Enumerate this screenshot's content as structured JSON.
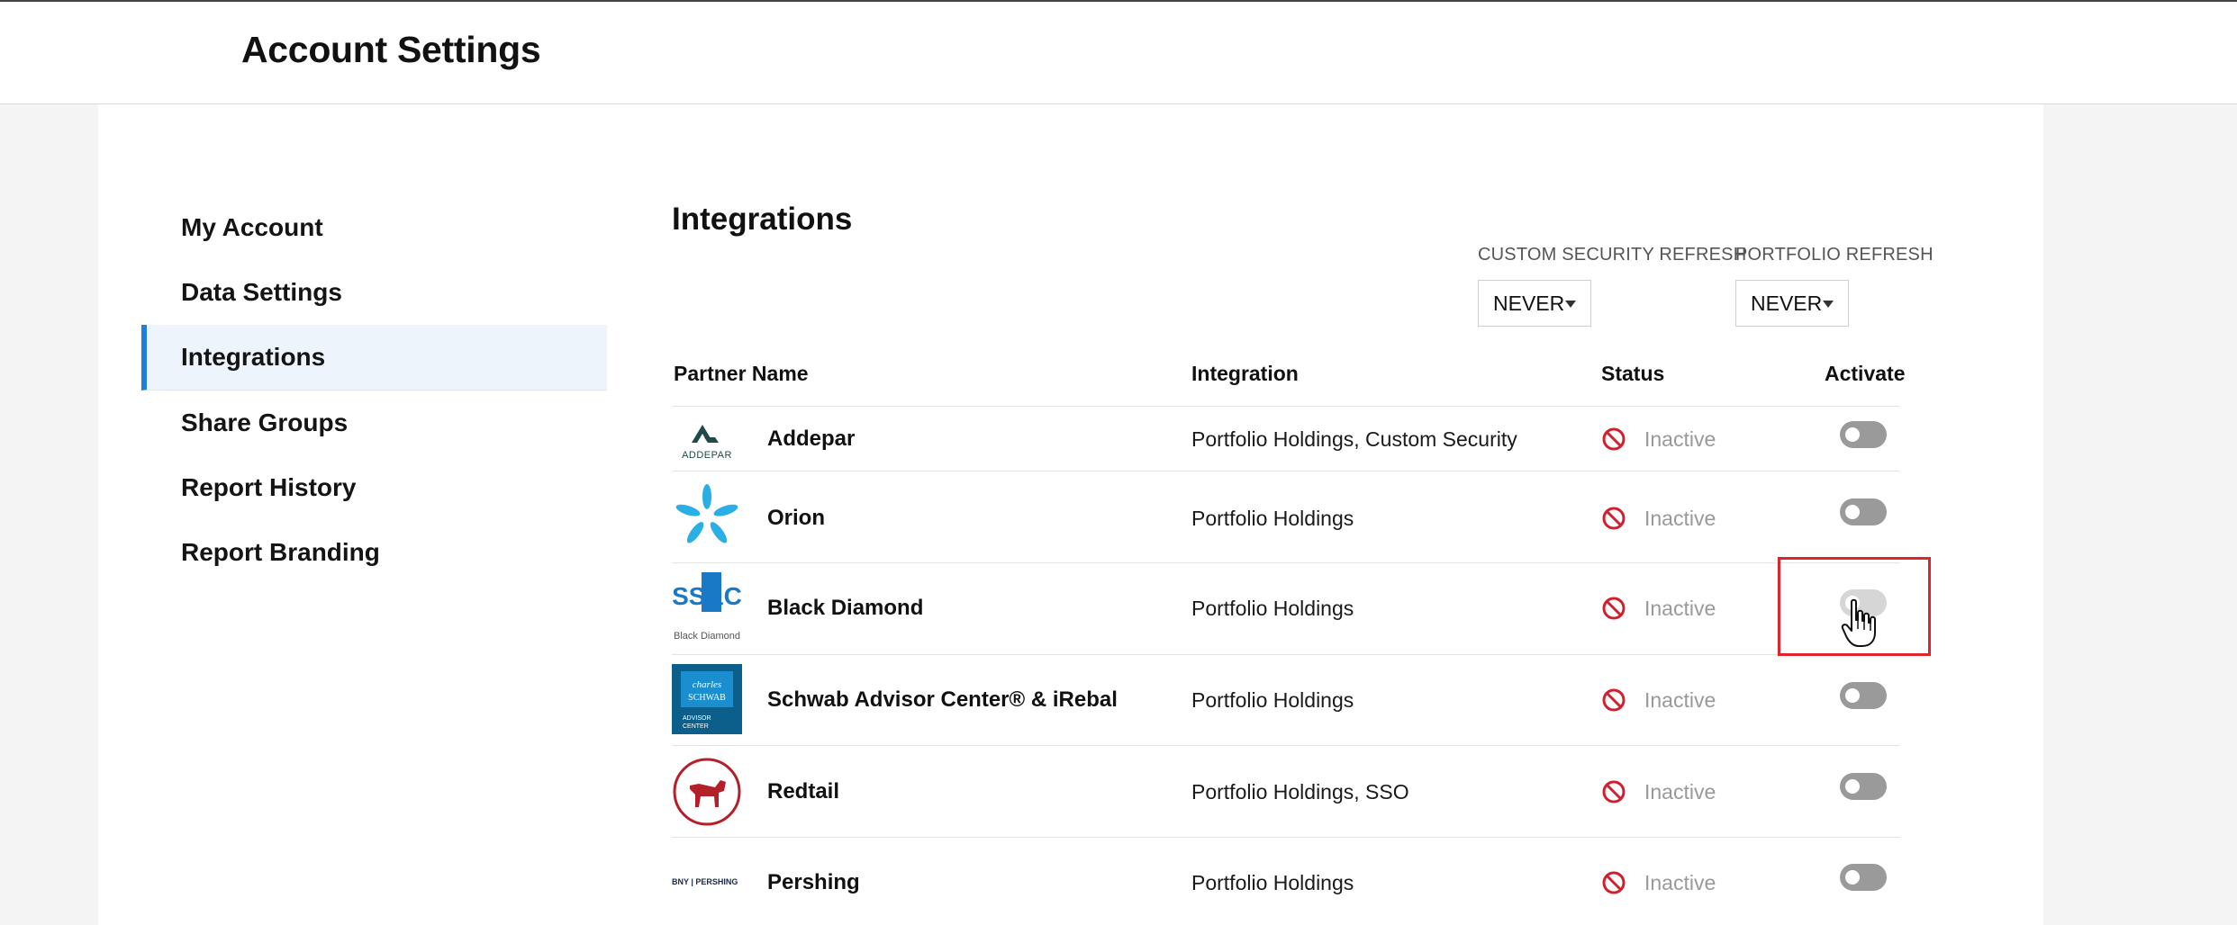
{
  "header": {
    "title": "Account Settings"
  },
  "sidebar": {
    "items": [
      {
        "label": "My Account",
        "active": false
      },
      {
        "label": "Data Settings",
        "active": false
      },
      {
        "label": "Integrations",
        "active": true
      },
      {
        "label": "Share Groups",
        "active": false
      },
      {
        "label": "Report History",
        "active": false
      },
      {
        "label": "Report Branding",
        "active": false
      }
    ]
  },
  "main": {
    "title": "Integrations",
    "custom_security_refresh": {
      "label": "CUSTOM SECURITY REFRESH",
      "value": "NEVER"
    },
    "portfolio_refresh": {
      "label": "PORTFOLIO REFRESH",
      "value": "NEVER"
    },
    "table": {
      "headers": {
        "partner_name": "Partner Name",
        "integration": "Integration",
        "status": "Status",
        "activate": "Activate"
      },
      "rows": [
        {
          "partner": "Addepar",
          "integration": "Portfolio Holdings, Custom Security",
          "status": "Inactive",
          "active": false,
          "logo_text": "ADDEPAR"
        },
        {
          "partner": "Orion",
          "integration": "Portfolio Holdings",
          "status": "Inactive",
          "active": false
        },
        {
          "partner": "Black Diamond",
          "integration": "Portfolio Holdings",
          "status": "Inactive",
          "active": false,
          "logo_text": "Black Diamond",
          "logo_mark": "SS&C"
        },
        {
          "partner": "Schwab Advisor Center® & iRebal",
          "integration": "Portfolio Holdings",
          "status": "Inactive",
          "active": false,
          "logo_text": "charles SCHWAB",
          "logo_sub": "ADVISOR CENTER"
        },
        {
          "partner": "Redtail",
          "integration": "Portfolio Holdings, SSO",
          "status": "Inactive",
          "active": false
        },
        {
          "partner": "Pershing",
          "integration": "Portfolio Holdings",
          "status": "Inactive",
          "active": false,
          "logo_text": "BNY | PERSHING"
        }
      ]
    }
  },
  "colors": {
    "accent": "#1e7fe0",
    "inactive_icon": "#d0202e",
    "highlight": "#e0242b",
    "toggle_off": "#9a9a9a"
  },
  "icons": {
    "status": "prohibited-icon",
    "cursor": "hand-pointer-icon"
  }
}
